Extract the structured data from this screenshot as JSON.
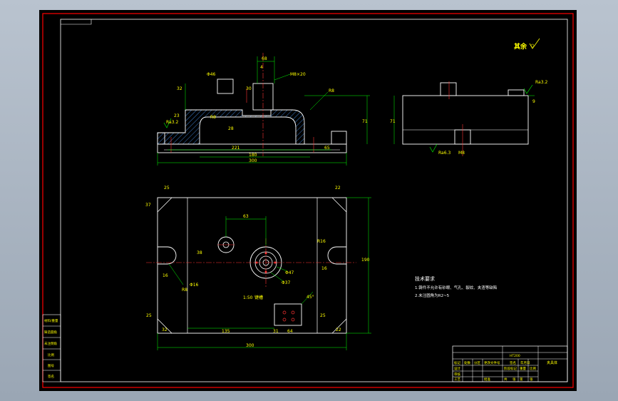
{
  "colors": {
    "background": "#000000",
    "border": "#ff0000",
    "outline": "#ffffff",
    "dimension": "#00ff00",
    "centerline": "#ff3333",
    "hatch": "#4a9cff",
    "text": "#ffff00"
  },
  "roughness_note": "其余",
  "front_dims": {
    "d_top_width": "68",
    "d_depth": "4",
    "d_fit": "M8×20",
    "d_boss": "Φ46",
    "d_r": "R8",
    "d_left_h": "32",
    "d_chamfer": "30",
    "d_left_step": "23",
    "d_r2": "R8",
    "d_mid_h": "28",
    "d_mid_w": "221",
    "d_right_step": "65",
    "d_inner_w": "180",
    "d_total_w": "300",
    "d_height": "71",
    "d_left_rough": "Ra3.2"
  },
  "side_dims": {
    "d_height": "71",
    "d_rough_top": "Ra3.2",
    "d_right_h": "9",
    "d_rough_bottom": "Ra6.3",
    "d_slot": "M8"
  },
  "top_dims": {
    "d_corner_tl": "25",
    "d_corner_tr": "22",
    "d_left_side": "37",
    "d_center_dist": "63",
    "d_hole_off": "38",
    "d_slot_r": "R16",
    "d_slot_w": "16",
    "d_phi16": "Φ16",
    "d_phi47": "Φ47",
    "d_phi37": "Φ37",
    "d_r8": "R8",
    "d_depth": "190",
    "d_ratio": "1:50",
    "d_key": "键槽",
    "d_angle": "45°",
    "d_bl": "25",
    "d_br": "25",
    "d_bot_l": "32",
    "d_bot_r": "22",
    "d_bot_mid": "135",
    "d_bot_31": "31",
    "d_bot_64": "64",
    "d_total": "300"
  },
  "tech_req": {
    "title": "技术要求",
    "line1": "1.铸件不允许有砂眼、气孔、裂纹、夹渣等缺陷",
    "line2": "2.未注圆角为R2~5"
  },
  "side_table": [
    "材料/重量",
    "铸造圆角",
    "未注倒角",
    "比例",
    "图号",
    "签名"
  ],
  "title_block": {
    "material": "HT200",
    "drawing_name": "夹具体",
    "rows": [
      "标记",
      "处数",
      "分区",
      "更改文件号",
      "签名",
      "年月日"
    ],
    "labels": [
      "设计",
      "审核",
      "工艺",
      "批准"
    ],
    "stage": [
      "阶段标记",
      "重量",
      "比例"
    ],
    "sheet": [
      "共",
      "张",
      "第",
      "张"
    ]
  }
}
